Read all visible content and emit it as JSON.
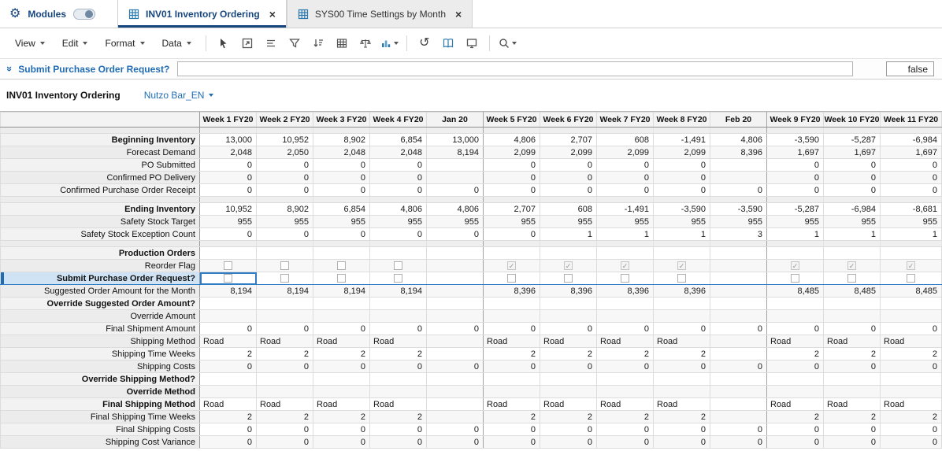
{
  "colors": {
    "accent_blue": "#1f6cb5",
    "selection_blue": "#2f7cc4",
    "tab_navy": "#17467e",
    "chart_icon_blue": "#2a7ab0"
  },
  "top_bar": {
    "modules_label": "Modules",
    "tabs": [
      {
        "label": "INV01 Inventory Ordering",
        "close": "×",
        "active": true
      },
      {
        "label": "SYS00 Time Settings by Month",
        "close": "×",
        "active": false
      }
    ]
  },
  "menubar": {
    "menus": [
      {
        "label": "View"
      },
      {
        "label": "Edit"
      },
      {
        "label": "Format"
      },
      {
        "label": "Data"
      }
    ],
    "icons": [
      "pointer",
      "open-view",
      "hide-show",
      "filter",
      "sort",
      "grid",
      "balance",
      "bar-chart",
      "undo",
      "book",
      "monitor",
      "search"
    ]
  },
  "formula_bar": {
    "label": "Submit Purchase Order Request?",
    "input_value": "",
    "result": "false"
  },
  "view_header": {
    "title": "INV01 Inventory Ordering",
    "page_selector": "Nutzo Bar_EN"
  },
  "grid": {
    "columns": [
      "Week 1 FY20",
      "Week 2 FY20",
      "Week 3 FY20",
      "Week 4 FY20",
      "Jan 20",
      "Week 5 FY20",
      "Week 6 FY20",
      "Week 7 FY20",
      "Week 8 FY20",
      "Feb 20",
      "Week 9 FY20",
      "Week 10 FY20",
      "Week 11 FY20"
    ],
    "month_columns": [
      4,
      9
    ],
    "rows": [
      {
        "type": "spacer"
      },
      {
        "label": "Beginning Inventory",
        "bold": true,
        "cells": [
          "13,000",
          "10,952",
          "8,902",
          "6,854",
          "13,000",
          "4,806",
          "2,707",
          "608",
          "-1,491",
          "4,806",
          "-3,590",
          "-5,287",
          "-6,984"
        ]
      },
      {
        "label": "Forecast Demand",
        "indent": 1,
        "cells": [
          "2,048",
          "2,050",
          "2,048",
          "2,048",
          "8,194",
          "2,099",
          "2,099",
          "2,099",
          "2,099",
          "8,396",
          "1,697",
          "1,697",
          "1,697"
        ]
      },
      {
        "label": "PO Submitted",
        "indent": 1,
        "cells": [
          "0",
          "0",
          "0",
          "0",
          "",
          "0",
          "0",
          "0",
          "0",
          "",
          "0",
          "0",
          "0"
        ]
      },
      {
        "label": "Confirmed PO Delivery",
        "indent": 1,
        "cells": [
          "0",
          "0",
          "0",
          "0",
          "",
          "0",
          "0",
          "0",
          "0",
          "",
          "0",
          "0",
          "0"
        ]
      },
      {
        "label": "Confirmed Purchase Order Receipt",
        "indent": 1,
        "cells": [
          "0",
          "0",
          "0",
          "0",
          "0",
          "0",
          "0",
          "0",
          "0",
          "0",
          "0",
          "0",
          "0"
        ]
      },
      {
        "type": "spacer"
      },
      {
        "label": "Ending Inventory",
        "bold": true,
        "cells": [
          "10,952",
          "8,902",
          "6,854",
          "4,806",
          "4,806",
          "2,707",
          "608",
          "-1,491",
          "-3,590",
          "-3,590",
          "-5,287",
          "-6,984",
          "-8,681"
        ]
      },
      {
        "label": "Safety Stock Target",
        "indent": 1,
        "cells": [
          "955",
          "955",
          "955",
          "955",
          "955",
          "955",
          "955",
          "955",
          "955",
          "955",
          "955",
          "955",
          "955"
        ]
      },
      {
        "label": "Safety Stock Exception Count",
        "indent": 1,
        "cells": [
          "0",
          "0",
          "0",
          "0",
          "0",
          "0",
          "1",
          "1",
          "1",
          "3",
          "1",
          "1",
          "1"
        ]
      },
      {
        "type": "spacer"
      },
      {
        "label": "Production Orders",
        "bold": true,
        "cells": [
          "",
          "",
          "",
          "",
          "",
          "",
          "",
          "",
          "",
          "",
          "",
          "",
          ""
        ]
      },
      {
        "label": "Reorder Flag",
        "indent": 1,
        "cell_type": "checkbox",
        "cells": [
          false,
          false,
          false,
          false,
          null,
          true,
          true,
          true,
          true,
          null,
          true,
          true,
          true
        ]
      },
      {
        "label": "Submit Purchase Order Request?",
        "bold": true,
        "selected": true,
        "cell_type": "checkbox",
        "cells": [
          false,
          false,
          false,
          false,
          null,
          false,
          false,
          false,
          false,
          null,
          false,
          false,
          false
        ]
      },
      {
        "label": "Suggested Order Amount for the Month",
        "indent": 1,
        "cells": [
          "8,194",
          "8,194",
          "8,194",
          "8,194",
          "",
          "8,396",
          "8,396",
          "8,396",
          "8,396",
          "",
          "8,485",
          "8,485",
          "8,485"
        ]
      },
      {
        "label": "Override Suggested Order Amount?",
        "bold": true,
        "cells": [
          "",
          "",
          "",
          "",
          "",
          "",
          "",
          "",
          "",
          "",
          "",
          "",
          ""
        ]
      },
      {
        "label": "Override Amount",
        "indent": 1,
        "cells": [
          "",
          "",
          "",
          "",
          "",
          "",
          "",
          "",
          "",
          "",
          "",
          "",
          ""
        ]
      },
      {
        "label": "Final Shipment Amount",
        "indent": 1,
        "cells": [
          "0",
          "0",
          "0",
          "0",
          "0",
          "0",
          "0",
          "0",
          "0",
          "0",
          "0",
          "0",
          "0"
        ]
      },
      {
        "label": "Shipping Method",
        "indent": 1,
        "align": "left",
        "cells": [
          "Road",
          "Road",
          "Road",
          "Road",
          "",
          "Road",
          "Road",
          "Road",
          "Road",
          "",
          "Road",
          "Road",
          "Road"
        ]
      },
      {
        "label": "Shipping Time Weeks",
        "indent": 1,
        "cells": [
          "2",
          "2",
          "2",
          "2",
          "",
          "2",
          "2",
          "2",
          "2",
          "",
          "2",
          "2",
          "2"
        ]
      },
      {
        "label": "Shipping Costs",
        "indent": 1,
        "cells": [
          "0",
          "0",
          "0",
          "0",
          "0",
          "0",
          "0",
          "0",
          "0",
          "0",
          "0",
          "0",
          "0"
        ]
      },
      {
        "label": "Override Shipping Method?",
        "bold": true,
        "cells": [
          "",
          "",
          "",
          "",
          "",
          "",
          "",
          "",
          "",
          "",
          "",
          "",
          ""
        ]
      },
      {
        "label": "Override Method",
        "bold": true,
        "cells": [
          "",
          "",
          "",
          "",
          "",
          "",
          "",
          "",
          "",
          "",
          "",
          "",
          ""
        ]
      },
      {
        "label": "Final Shipping Method",
        "bold": true,
        "align": "left",
        "section_top": true,
        "cells": [
          "Road",
          "Road",
          "Road",
          "Road",
          "",
          "Road",
          "Road",
          "Road",
          "Road",
          "",
          "Road",
          "Road",
          "Road"
        ]
      },
      {
        "label": "Final Shipping Time Weeks",
        "indent": 1,
        "cells": [
          "2",
          "2",
          "2",
          "2",
          "",
          "2",
          "2",
          "2",
          "2",
          "",
          "2",
          "2",
          "2"
        ]
      },
      {
        "label": "Final Shipping Costs",
        "indent": 1,
        "cells": [
          "0",
          "0",
          "0",
          "0",
          "0",
          "0",
          "0",
          "0",
          "0",
          "0",
          "0",
          "0",
          "0"
        ]
      },
      {
        "label": "Shipping Cost Variance",
        "indent": 1,
        "cells": [
          "0",
          "0",
          "0",
          "0",
          "0",
          "0",
          "0",
          "0",
          "0",
          "0",
          "0",
          "0",
          "0"
        ]
      }
    ]
  }
}
